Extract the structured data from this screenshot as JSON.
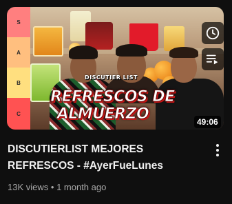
{
  "video": {
    "thumbnail": {
      "tiers": [
        "S",
        "A",
        "B",
        "C"
      ],
      "overlay_subtitle": "DISCUTIER LIST",
      "overlay_title_line1": "REFRESCOS DE",
      "overlay_title_line2": "ALMUERZO",
      "shirt_text": "",
      "duration": "49:06",
      "buttons": [
        "clock-icon",
        "add-to-queue-icon"
      ]
    },
    "title_line1": "DISCUTIERLIST MEJORES",
    "title_line2": "REFRESCOS - #AyerFueLunes",
    "views": "13K views",
    "separator": "•",
    "age": "1 month ago",
    "menu_icon": "vertical-dots-icon"
  },
  "colors": {
    "background": "#0f0f0f",
    "title": "#f1f1f1",
    "meta": "#aaaaaa",
    "tier_s": "#ff7f7f",
    "tier_a": "#ffbf7f",
    "tier_b": "#ffdf7f",
    "tier_c": "#ff5252"
  }
}
